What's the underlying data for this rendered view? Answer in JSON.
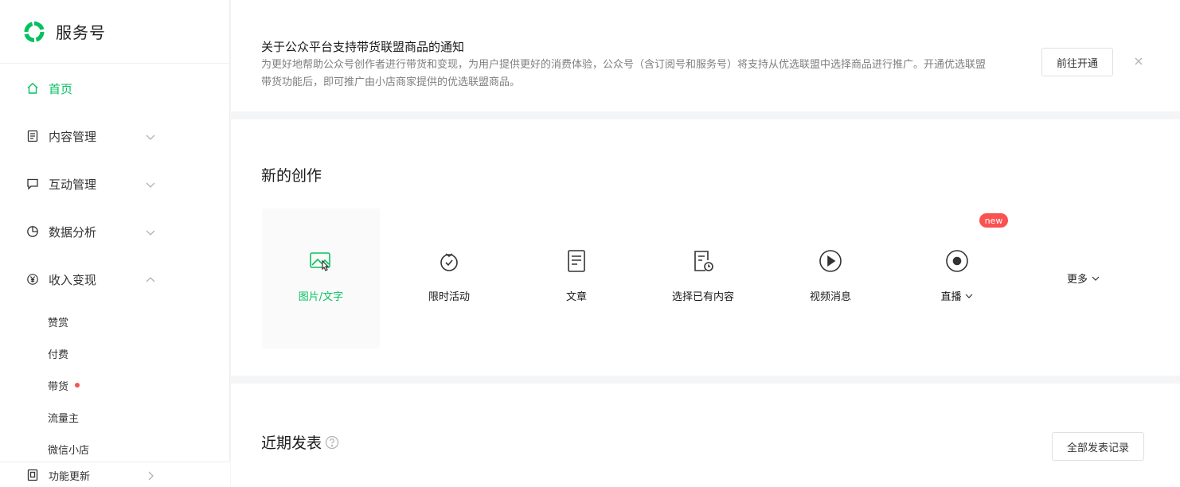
{
  "brand": {
    "name": "服务号",
    "logo_icon": "wechat-service-logo-icon",
    "accent": "#07c160"
  },
  "sidebar": {
    "items": [
      {
        "label": "首页",
        "icon": "home-icon",
        "active": true
      },
      {
        "label": "内容管理",
        "icon": "document-icon"
      },
      {
        "label": "互动管理",
        "icon": "chat-bubble-icon"
      },
      {
        "label": "数据分析",
        "icon": "pie-chart-icon"
      },
      {
        "label": "收入变现",
        "icon": "yen-icon",
        "expanded": true
      }
    ],
    "subitems": [
      {
        "label": "赞赏"
      },
      {
        "label": "付费"
      },
      {
        "label": "带货",
        "dot": true
      },
      {
        "label": "流量主"
      },
      {
        "label": "微信小店"
      }
    ],
    "footer": {
      "label": "功能更新",
      "icon": "book-icon"
    }
  },
  "notice": {
    "title": "关于公众平台支持带货联盟商品的通知",
    "desc": "为更好地帮助公众号创作者进行带货和变现，为用户提供更好的消费体验，公众号（含订阅号和服务号）将支持从优选联盟中选择商品进行推广。开通优选联盟带货功能后，即可推广由小店商家提供的优选联盟商品。",
    "button": "前往开通"
  },
  "create": {
    "title": "新的创作",
    "tiles": [
      {
        "label": "图片/文字",
        "icon": "image-text-icon"
      },
      {
        "label": "限时活动",
        "icon": "timer-activity-icon"
      },
      {
        "label": "文章",
        "icon": "article-icon"
      },
      {
        "label": "选择已有内容",
        "icon": "existing-content-icon"
      },
      {
        "label": "视频消息",
        "icon": "video-play-icon"
      },
      {
        "label": "直播",
        "icon": "live-record-icon"
      }
    ],
    "new_badge": "new",
    "more": "更多"
  },
  "recent": {
    "title": "近期发表",
    "button": "全部发表记录"
  }
}
